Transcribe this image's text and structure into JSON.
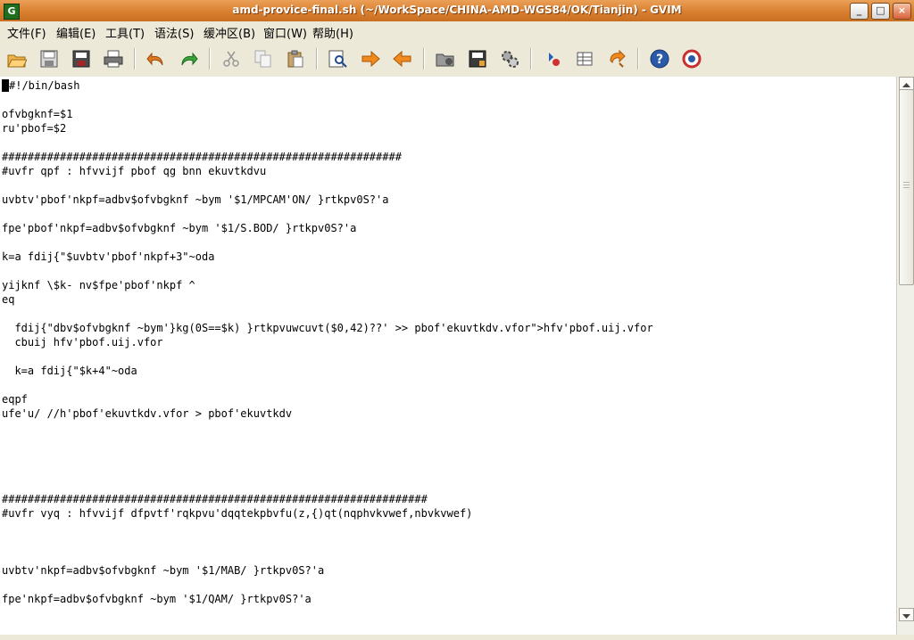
{
  "window": {
    "title": "amd-provice-final.sh (~/WorkSpace/CHINA-AMD-WGS84/OK/Tianjin) - GVIM",
    "app_icon": "G",
    "minimize": "_",
    "maximize": "□",
    "close": "×"
  },
  "menu": {
    "items": [
      "文件(F)",
      "编辑(E)",
      "工具(T)",
      "语法(S)",
      "缓冲区(B)",
      "窗口(W)",
      "帮助(H)"
    ]
  },
  "toolbar": {
    "icons": [
      "open-icon",
      "save-icon",
      "save-all-icon",
      "print-icon",
      "undo-icon",
      "redo-icon",
      "cut-icon",
      "copy-icon",
      "paste-icon",
      "find-replace-icon",
      "find-next-icon",
      "find-prev-icon",
      "load-session-icon",
      "save-session-icon",
      "run-script-icon",
      "make-icon",
      "build-tags-icon",
      "jump-tag-icon",
      "help-icon",
      "find-help-icon"
    ]
  },
  "editor": {
    "lines": [
      "#!/bin/bash",
      "",
      "ofvbgknf=$1",
      "ru'pbof=$2",
      "",
      "##############################################################",
      "#uvfr qpf : hfvvijf pbof qg bnn ekuvtkdvu",
      "",
      "uvbtv'pbof'nkpf=adbv$ofvbgknf ~bym '$1/MPCAM'ON/ }rtkpv0S?'a",
      "",
      "fpe'pbof'nkpf=adbv$ofvbgknf ~bym '$1/S.BOD/ }rtkpv0S?'a",
      "",
      "k=a fdij{\"$uvbtv'pbof'nkpf+3\"~oda",
      "",
      "yijknf \\$k- nv$fpe'pbof'nkpf ^",
      "eq",
      "",
      "  fdij{\"dbv$ofvbgknf ~bym'}kg(0S==$k) }rtkpvuwcuvt($0,42)??' >> pbof'ekuvtkdv.vfor\">hfv'pbof.uij.vfor",
      "  cbuij hfv'pbof.uij.vfor",
      "",
      "  k=a fdij{\"$k+4\"~oda",
      "",
      "eqpf",
      "ufe'u/ //h'pbof'ekuvtkdv.vfor > pbof'ekuvtkdv",
      "",
      "",
      "",
      "",
      "",
      "##################################################################",
      "#uvfr vyq : hfvvijf dfpvtf'rqkpvu'dqqtekpbvfu(z,{)qt(nqphvkvwef,nbvkvwef)",
      "",
      "",
      "",
      "uvbtv'nkpf=adbv$ofvbgknf ~bym '$1/MAB/ }rtkpv0S?'a",
      "",
      "fpe'nkpf=adbv$ofvbgknf ~bym '$1/QAM/ }rtkpv0S?'a"
    ]
  }
}
